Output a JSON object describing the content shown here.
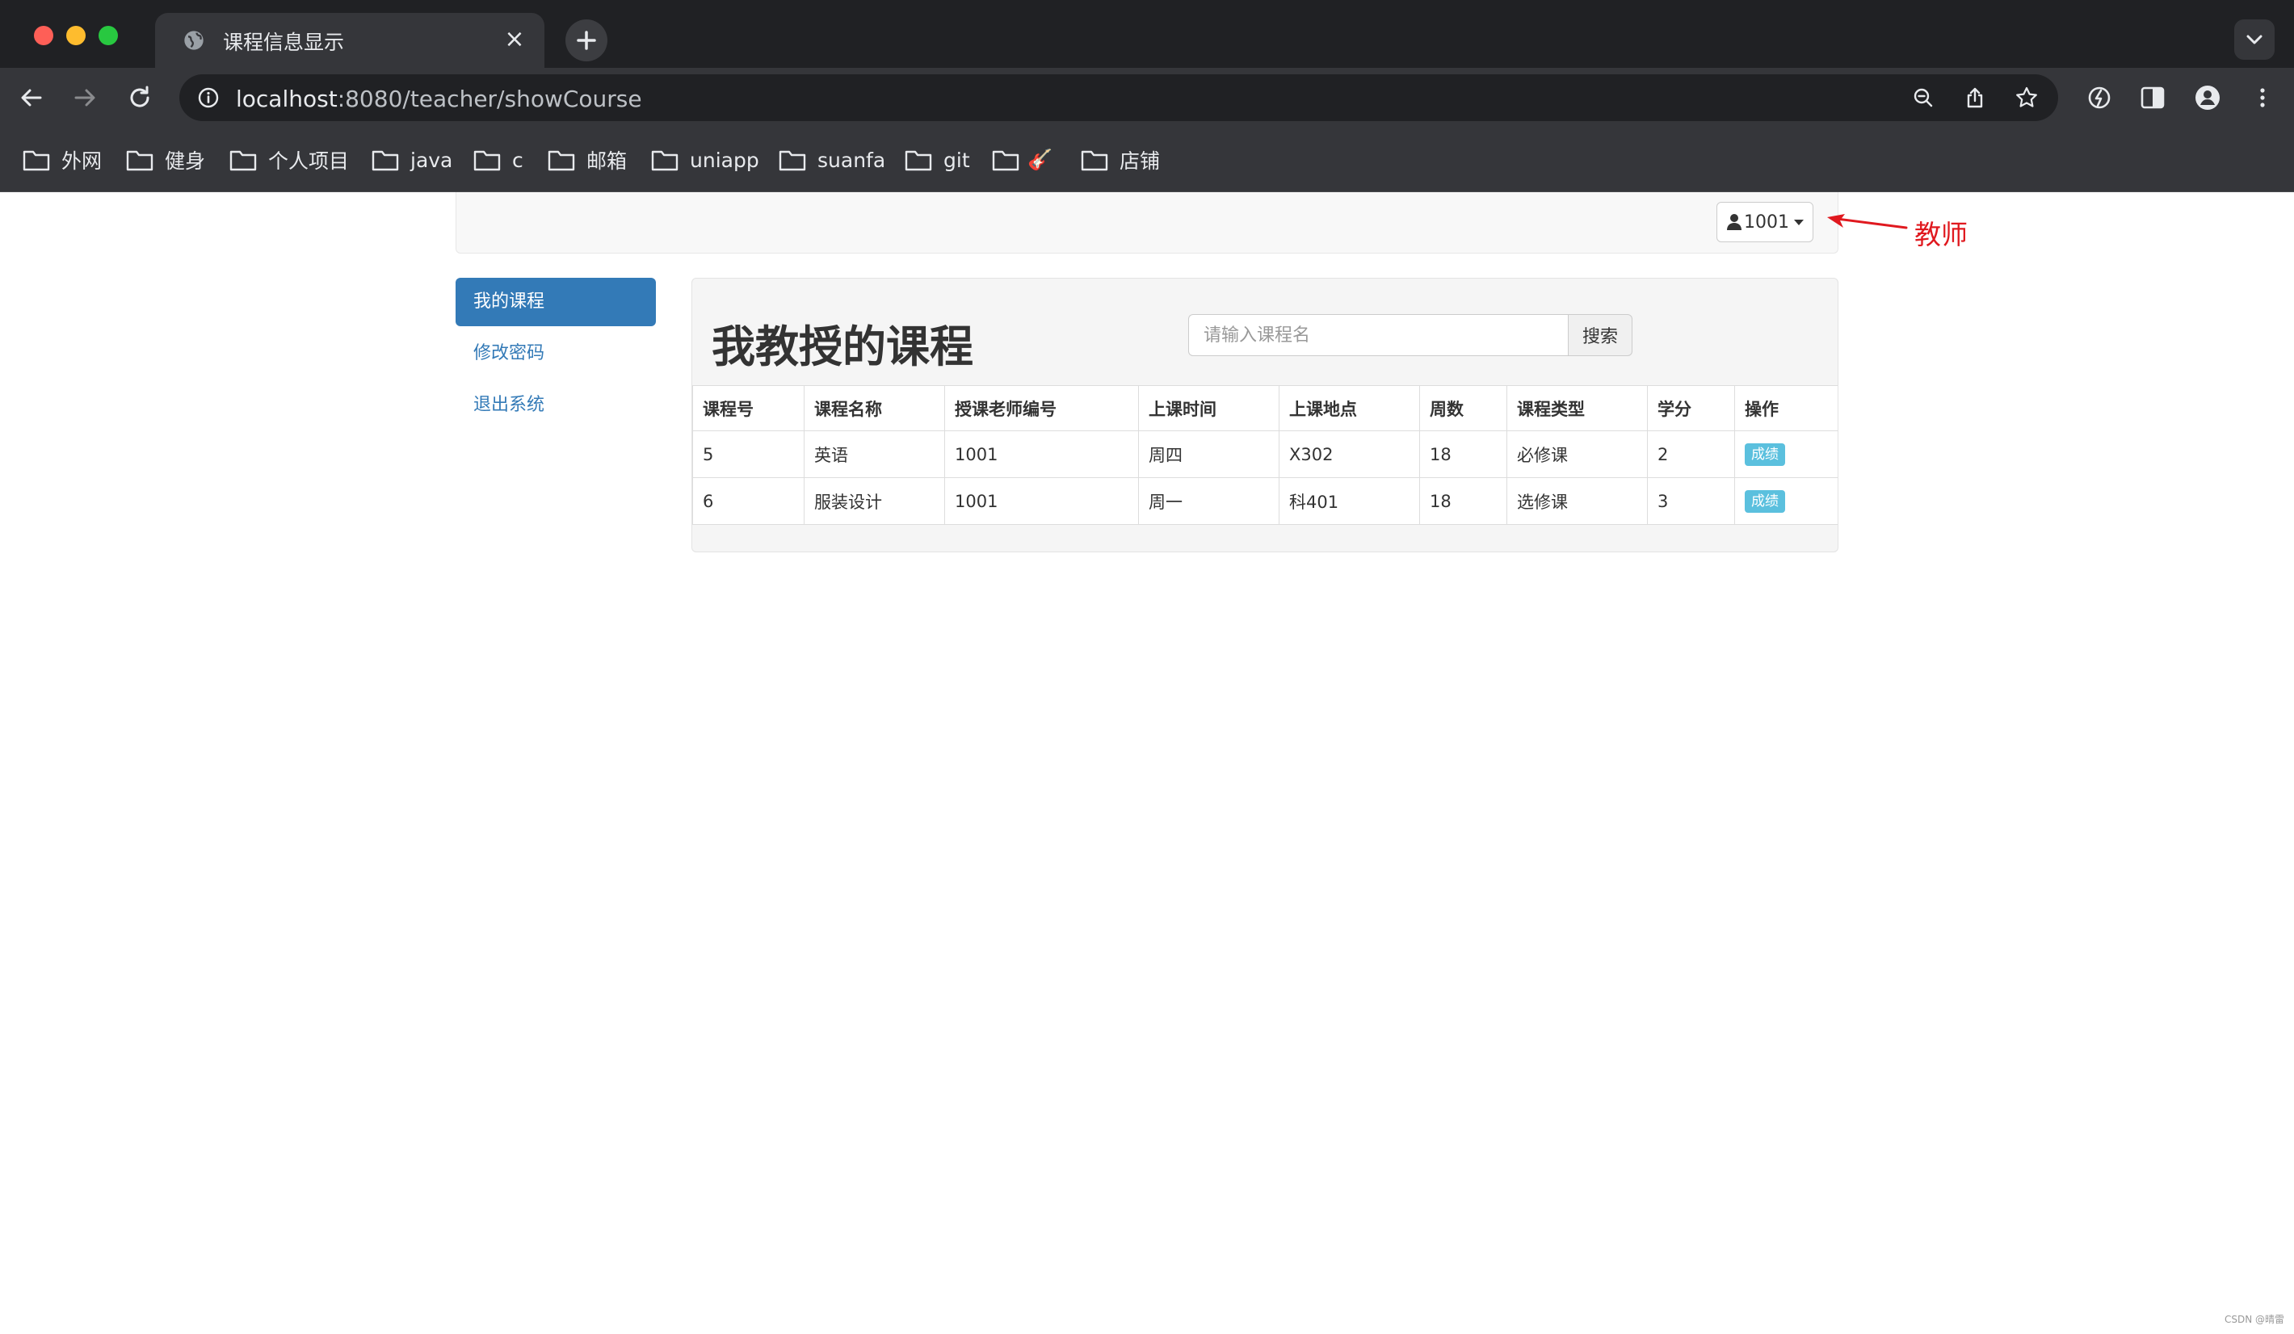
{
  "browser": {
    "tab_title": "课程信息显示",
    "close_glyph": "×",
    "url_host": "localhost",
    "url_rest": ":8080/teacher/showCourse",
    "bookmarks": [
      "外网",
      "健身",
      "个人项目",
      "java",
      "c",
      "邮箱",
      "uniapp",
      "suanfa",
      "git",
      "🎸",
      "店铺"
    ]
  },
  "navbar": {
    "user_label": "1001",
    "annotation": "教师"
  },
  "sidebar": {
    "items": [
      {
        "label": "我的课程"
      },
      {
        "label": "修改密码"
      },
      {
        "label": "退出系统"
      }
    ]
  },
  "main": {
    "title": "我教授的课程",
    "search_placeholder": "请输入课程名",
    "search_label": "搜索",
    "table": {
      "headers": [
        "课程号",
        "课程名称",
        "授课老师编号",
        "上课时间",
        "上课地点",
        "周数",
        "课程类型",
        "学分",
        "操作"
      ],
      "rows": [
        [
          "5",
          "英语",
          "1001",
          "周四",
          "X302",
          "18",
          "必修课",
          "2",
          "成绩"
        ],
        [
          "6",
          "服装设计",
          "1001",
          "周一",
          "科401",
          "18",
          "选修课",
          "3",
          "成绩"
        ]
      ]
    }
  },
  "footer": {
    "credit": "CSDN @晴雷"
  }
}
